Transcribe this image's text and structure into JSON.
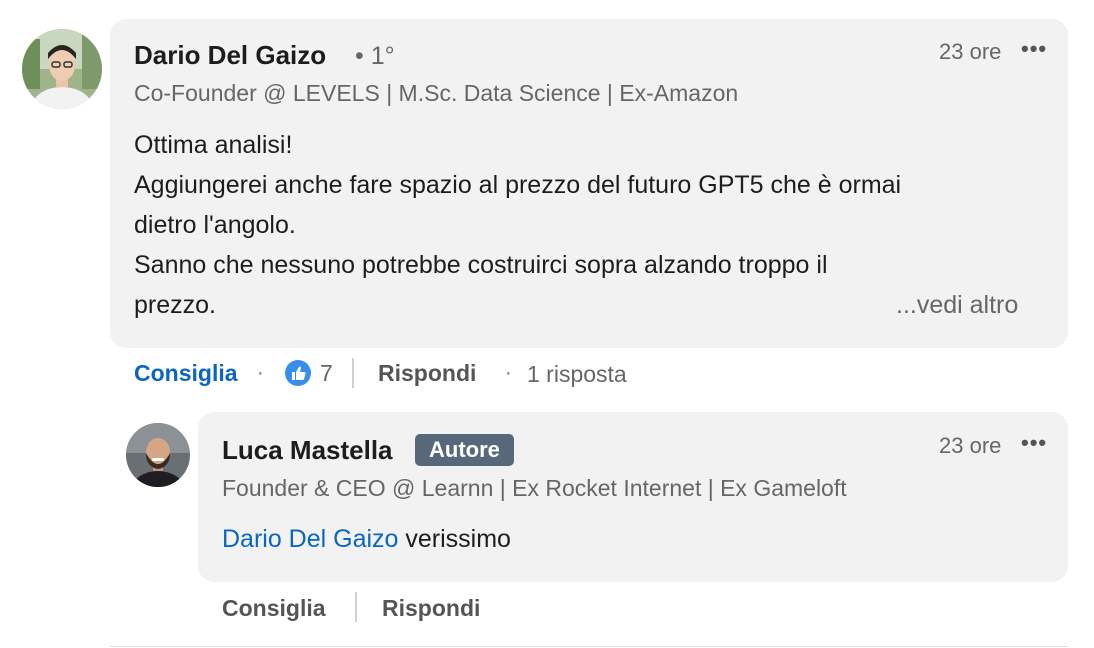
{
  "comment": {
    "author": "Dario Del Gaizo",
    "degree": "• 1°",
    "headline": "Co-Founder @ LEVELS | M.Sc. Data Science | Ex-Amazon",
    "time": "23 ore",
    "more_icon": "ellipsis-icon",
    "lines": [
      "Ottima analisi!",
      "Aggiungerei anche fare spazio al prezzo del futuro GPT5 che è ormai",
      "dietro l'angolo.",
      "Sanno che nessuno potrebbe costruirci sopra alzando troppo il",
      "prezzo."
    ],
    "see_more": "...vedi altro",
    "actions": {
      "like": "Consiglia",
      "like_count": "7",
      "reply": "Rispondi",
      "replies": "1 risposta"
    }
  },
  "reply": {
    "author": "Luca Mastella",
    "badge": "Autore",
    "headline": "Founder & CEO @ Learnn | Ex Rocket Internet | Ex Gameloft",
    "time": "23 ore",
    "mention": "Dario Del Gaizo",
    "text": " verissimo",
    "actions": {
      "like": "Consiglia",
      "reply": "Rispondi"
    }
  },
  "colors": {
    "link": "#0a66c2",
    "bubble": "#f2f2f2",
    "badge": "#56687a",
    "like_reaction": "#378fe9"
  }
}
